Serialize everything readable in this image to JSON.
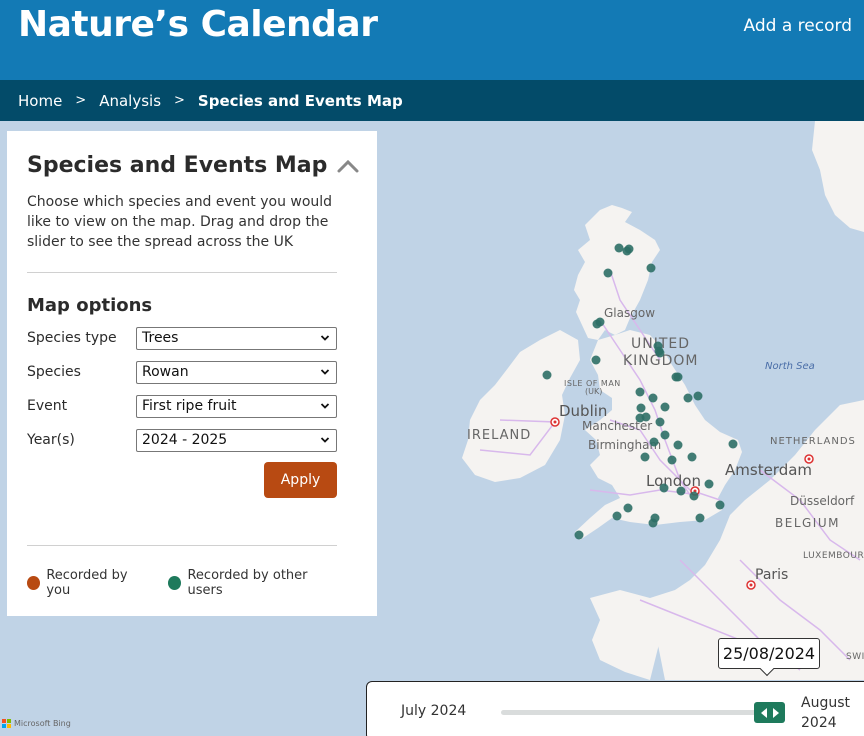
{
  "header": {
    "site_title": "Nature’s Calendar",
    "add_record": "Add a record"
  },
  "breadcrumb": {
    "items": [
      "Home",
      "Analysis",
      "Species and Events Map"
    ],
    "separator": ">"
  },
  "panel": {
    "title": "Species and Events Map",
    "description": "Choose which species and event you would like to view on the map. Drag and drop the slider to see the spread across the UK",
    "collapse_icon": "chevron-up-icon",
    "map_options": {
      "title": "Map options",
      "fields": [
        {
          "label": "Species type",
          "value": "Trees"
        },
        {
          "label": "Species",
          "value": "Rowan"
        },
        {
          "label": "Event",
          "value": "First ripe fruit"
        },
        {
          "label": "Year(s)",
          "value": "2024 - 2025"
        }
      ],
      "apply_label": "Apply"
    },
    "legend": [
      {
        "label": "Recorded by you",
        "color": "#b84a12"
      },
      {
        "label": "Recorded by other users",
        "color": "#1e7a5c"
      }
    ]
  },
  "map": {
    "labels": {
      "glasgow": "Glasgow",
      "uk_line1": "UNITED",
      "uk_line2": "KINGDOM",
      "north_sea": "North Sea",
      "isle_of_man": "ISLE OF MAN",
      "isle_of_man_uk": "(UK)",
      "dublin": "Dublin",
      "ireland": "IRELAND",
      "manchester": "Manchester",
      "birmingham": "Birmingham",
      "london": "London",
      "amsterdam": "Amsterdam",
      "netherlands": "NETHERLANDS",
      "dusseldorf": "Düsseldorf",
      "belgium": "BELGIUM",
      "luxembourg": "LUXEMBOUR",
      "paris": "Paris",
      "switzerland": "SWI"
    },
    "attribution": "Microsoft Bing",
    "other_users_color": "#2e6f66",
    "record_count_other_users": 41,
    "record_count_you": 0
  },
  "slider": {
    "start_label": "July 2024",
    "end_label_line1": "August",
    "end_label_line2": "2024",
    "current_date": "25/08/2024",
    "position_fraction": 0.97
  }
}
